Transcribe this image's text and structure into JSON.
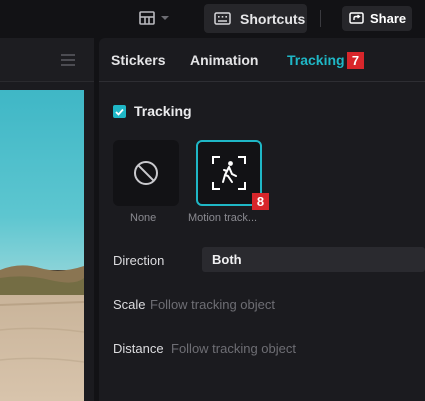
{
  "topbar": {
    "layout_icon": "layout-grid-icon",
    "shortcuts_label": "Shortcuts",
    "shortcuts_icon": "keyboard-icon",
    "share_label": "Share",
    "share_icon": "share-icon"
  },
  "tabs": [
    {
      "label": "Stickers",
      "active": false
    },
    {
      "label": "Animation",
      "active": false
    },
    {
      "label": "Tracking",
      "active": true
    }
  ],
  "badges": {
    "tracking_tab": "7",
    "motion_option": "8"
  },
  "tracking": {
    "checkbox_label": "Tracking",
    "checked": true,
    "options": [
      {
        "label": "None",
        "icon": "no-symbol-icon",
        "selected": false
      },
      {
        "label": "Motion track...",
        "icon": "motion-tracking-person-icon",
        "selected": true
      }
    ],
    "direction": {
      "label": "Direction",
      "value": "Both"
    },
    "scale": {
      "label": "Scale",
      "value": "Follow tracking object"
    },
    "distance": {
      "label": "Distance",
      "value": "Follow tracking object"
    }
  },
  "colors": {
    "accent": "#1fb7c6",
    "badge": "#d8262b",
    "panel": "#1b1b1f",
    "background": "#121215"
  }
}
